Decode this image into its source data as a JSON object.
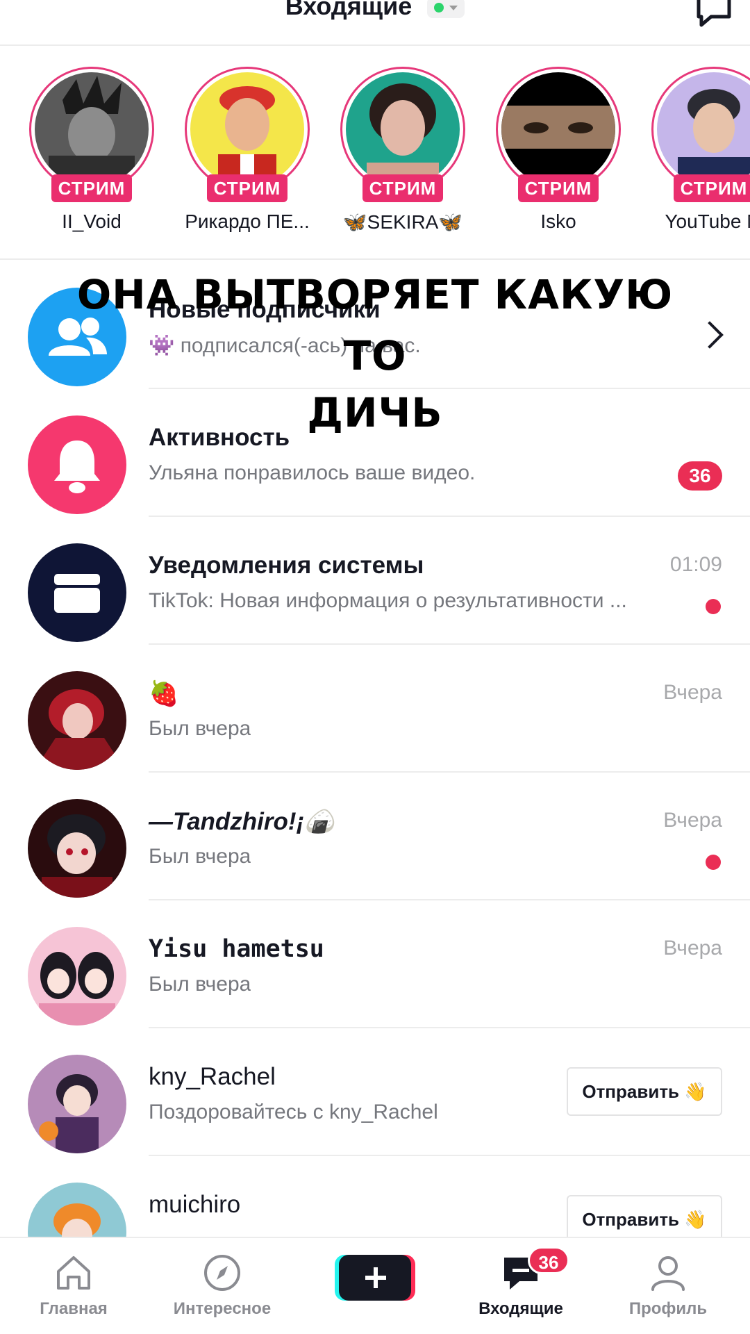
{
  "header": {
    "title": "Входящие",
    "status_icon": "online-status-dot",
    "compose_icon": "compose-message-icon"
  },
  "stories": [
    {
      "name": "II_Void",
      "badge": "СТРИМ"
    },
    {
      "name": "Рикардо ПЕ...",
      "badge": "СТРИМ"
    },
    {
      "name": "🦋SEKIRA🦋",
      "badge": "СТРИМ"
    },
    {
      "name": "Isko",
      "badge": "СТРИМ"
    },
    {
      "name": "YouTube M",
      "badge": "СТРИМ"
    }
  ],
  "overlay": {
    "line1": "ОНА ВЫТВОРЯЕТ КАКУЮ ТО",
    "line2": "ДИЧЬ"
  },
  "rows": [
    {
      "title": "Новые подписчики",
      "subtitle": "👾 подписался(-ась) на вас.",
      "icon": "followers-icon"
    },
    {
      "title": "Активность",
      "subtitle": "Ульяна понравилось ваше видео.",
      "badge": "36",
      "icon": "bell-icon"
    },
    {
      "title": "Уведомления системы",
      "subtitle": "TikTok: Новая информация о результативности ...",
      "time": "01:09",
      "icon": "inbox-icon"
    },
    {
      "title": "🍓",
      "subtitle": "Был вчера",
      "time": "Вчера"
    },
    {
      "title": "—Tandzhiro!¡🍙",
      "subtitle": "Был вчера",
      "time": "Вчера"
    },
    {
      "title": "Yisu hametsu",
      "subtitle": "Был вчера",
      "time": "Вчера"
    },
    {
      "title": "kny_Rachel",
      "subtitle": "Поздоровайтесь с kny_Rachel",
      "button": "Отправить 👋"
    },
    {
      "title": "muichiro",
      "subtitle": "",
      "button": "Отправить 👋"
    }
  ],
  "nav": {
    "home": "Главная",
    "discover": "Интересное",
    "inbox": "Входящие",
    "inbox_badge": "36",
    "profile": "Профиль"
  },
  "colors": {
    "accent": "#ea2e55",
    "live_badge": "#ea2e6e",
    "followers_icon_bg": "#1da1f2",
    "activity_icon_bg": "#f5386e",
    "system_icon_bg": "#0f1536"
  }
}
